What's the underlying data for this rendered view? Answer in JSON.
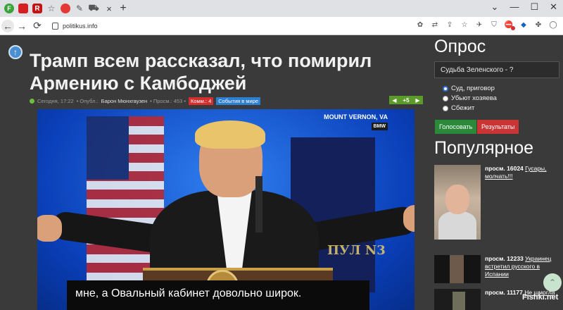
{
  "browser": {
    "tab_icons": [
      "F",
      "■",
      "R",
      "☆",
      "◉",
      "✎",
      "🚗"
    ],
    "new_tab": "+",
    "url": "politikus.info",
    "window_controls": [
      "⌄",
      "—",
      "☐",
      "✕"
    ],
    "nav": {
      "back": "←",
      "forward": "→",
      "reload": "⟳"
    }
  },
  "article": {
    "title": "Трамп всем рассказал, что помирил Армению с Камбоджей",
    "date": "Сегодня, 17:22",
    "published_by_label": "• Опубл.:",
    "author": "Барон Мюнхгаузен",
    "views": "• Просм.: 453 •",
    "comments_badge": "Комм.: 4",
    "category_badge": "События в мире",
    "rating": "+5"
  },
  "video": {
    "location_text": "MOUNT VERNON, VA",
    "channel_chip": "BMW",
    "watermark": "ПУЛ N3",
    "subtitle": "мне, а Овальный кабинет довольно широк."
  },
  "poll": {
    "heading": "Опрос",
    "question": "Судьба Зеленского - ?",
    "options": [
      "Суд, приговор",
      "Убьют хозяева",
      "Сбежит"
    ],
    "selected_index": 0,
    "vote_label": "Голосовать",
    "results_label": "Результаты"
  },
  "popular": {
    "heading": "Популярное",
    "items": [
      {
        "views": "просм. 16024",
        "title": "Гусары, молчать!!!"
      },
      {
        "views": "просм. 12233",
        "title": "Украинец встретил русского в Испании"
      },
      {
        "views": "просм. 11177",
        "title": "Не шмогла"
      }
    ]
  },
  "footer": {
    "brand": "Fishki.net"
  },
  "colors": {
    "page_bg": "#3a3a3a",
    "vote_green": "#2a8a3a",
    "results_red": "#c93535",
    "comments_red": "#d32f2f",
    "category_blue": "#2d7fd4"
  }
}
